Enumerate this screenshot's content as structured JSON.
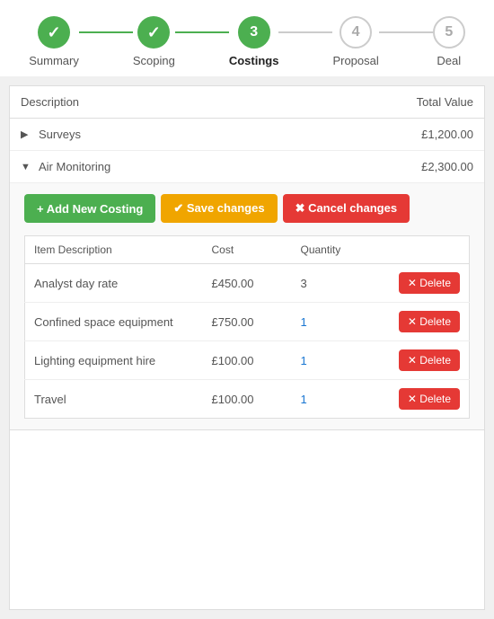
{
  "stepper": {
    "steps": [
      {
        "id": "summary",
        "label": "Summary",
        "state": "done",
        "number": "1"
      },
      {
        "id": "scoping",
        "label": "Scoping",
        "state": "done",
        "number": "2"
      },
      {
        "id": "costings",
        "label": "Costings",
        "state": "active",
        "number": "3"
      },
      {
        "id": "proposal",
        "label": "Proposal",
        "state": "inactive",
        "number": "4"
      },
      {
        "id": "deal",
        "label": "Deal",
        "state": "inactive",
        "number": "5"
      }
    ]
  },
  "table": {
    "col_description": "Description",
    "col_total": "Total Value",
    "rows": [
      {
        "id": "surveys",
        "label": "Surveys",
        "total": "£1,200.00",
        "expanded": false,
        "arrow": "▶"
      },
      {
        "id": "air-monitoring",
        "label": "Air Monitoring",
        "total": "£2,300.00",
        "expanded": true,
        "arrow": "▼"
      }
    ]
  },
  "actions": {
    "add_label": "+ Add New Costing",
    "save_label": "✔ Save changes",
    "cancel_label": "✖ Cancel changes"
  },
  "sub_table": {
    "col_item": "Item Description",
    "col_cost": "Cost",
    "col_qty": "Quantity",
    "col_action": "",
    "rows": [
      {
        "id": "analyst",
        "item": "Analyst day rate",
        "cost": "£450.00",
        "qty": "3",
        "qty_blue": false
      },
      {
        "id": "confined",
        "item": "Confined space equipment",
        "cost": "£750.00",
        "qty": "1",
        "qty_blue": true
      },
      {
        "id": "lighting",
        "item": "Lighting equipment hire",
        "cost": "£100.00",
        "qty": "1",
        "qty_blue": true
      },
      {
        "id": "travel",
        "item": "Travel",
        "cost": "£100.00",
        "qty": "1",
        "qty_blue": true
      }
    ],
    "delete_label": "✕ Delete"
  }
}
